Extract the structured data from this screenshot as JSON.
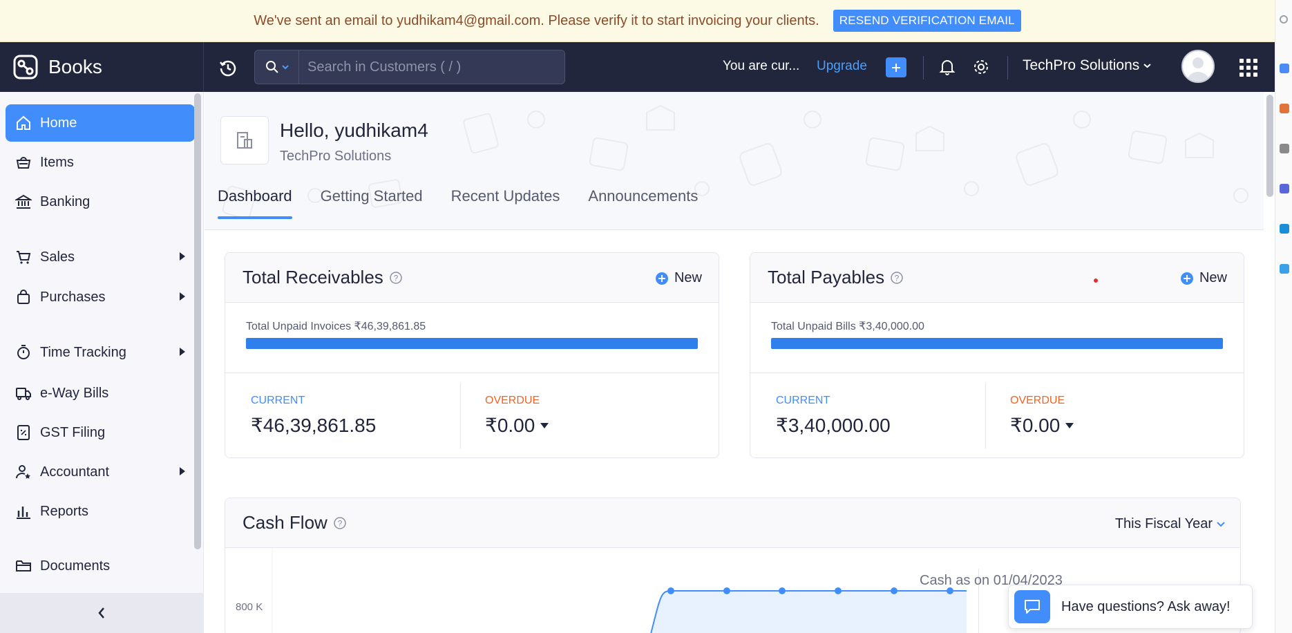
{
  "banner": {
    "message": "We've sent an email to yudhikam4@gmail.com. Please verify it to start invoicing your clients.",
    "button": "RESEND VERIFICATION EMAIL"
  },
  "app": {
    "brand": "Books"
  },
  "topbar": {
    "search_placeholder": "Search in Customers ( / )",
    "trial_text": "You are cur...",
    "upgrade": "Upgrade",
    "org_name": "TechPro Solutions"
  },
  "sidebar": {
    "items": [
      {
        "label": "Home",
        "icon": "home-icon",
        "active": true
      },
      {
        "label": "Items",
        "icon": "items-icon"
      },
      {
        "label": "Banking",
        "icon": "bank-icon"
      },
      {
        "label": "Sales",
        "icon": "cart-icon",
        "expandable": true
      },
      {
        "label": "Purchases",
        "icon": "bag-icon",
        "expandable": true
      },
      {
        "label": "Time Tracking",
        "icon": "timer-icon",
        "expandable": true
      },
      {
        "label": "e-Way Bills",
        "icon": "truck-icon"
      },
      {
        "label": "GST Filing",
        "icon": "gst-icon"
      },
      {
        "label": "Accountant",
        "icon": "accountant-icon",
        "expandable": true
      },
      {
        "label": "Reports",
        "icon": "reports-icon"
      },
      {
        "label": "Documents",
        "icon": "folder-icon"
      }
    ]
  },
  "header": {
    "greeting": "Hello, yudhikam4",
    "org": "TechPro Solutions",
    "tabs": [
      "Dashboard",
      "Getting Started",
      "Recent Updates",
      "Announcements"
    ],
    "active_tab": "Dashboard"
  },
  "receivables": {
    "title": "Total Receivables",
    "new": "New",
    "unpaid_label": "Total Unpaid Invoices ₹46,39,861.85",
    "progress_fraction": 1.0,
    "current_label": "CURRENT",
    "current_value": "₹46,39,861.85",
    "overdue_label": "OVERDUE",
    "overdue_value": "₹0.00"
  },
  "payables": {
    "title": "Total Payables",
    "new": "New",
    "unpaid_label": "Total Unpaid Bills ₹3,40,000.00",
    "progress_fraction": 1.0,
    "current_label": "CURRENT",
    "current_value": "₹3,40,000.00",
    "overdue_label": "OVERDUE",
    "overdue_value": "₹0.00"
  },
  "cashflow": {
    "title": "Cash Flow",
    "range": "This Fiscal Year",
    "as_of": "Cash as on 01/04/2023",
    "y_tick": "800 K"
  },
  "chat": {
    "label": "Have questions? Ask away!"
  },
  "colors": {
    "accent": "#408dfb",
    "navbar": "#21263c",
    "overdue": "#f26322",
    "banner_bg": "#fcf9e5",
    "banner_text": "#8c4b28"
  }
}
